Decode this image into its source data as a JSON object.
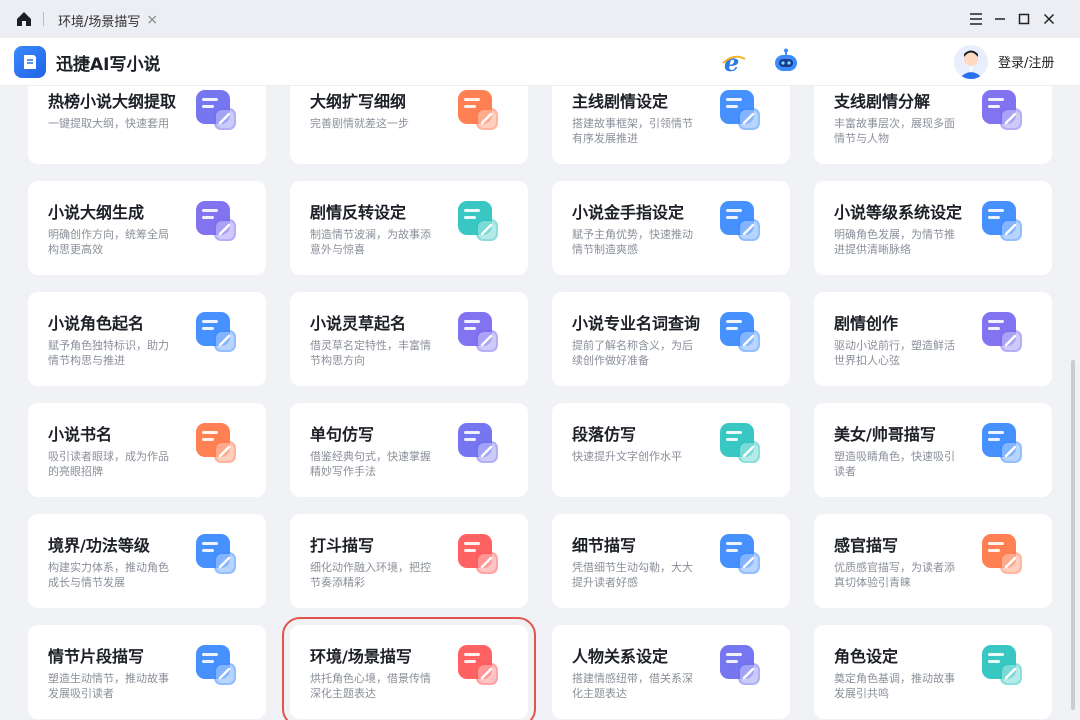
{
  "tab": {
    "label": "环境/场景描写",
    "close": "×"
  },
  "app": {
    "title": "迅捷AI写小说"
  },
  "header": {
    "login_label": "登录/注册"
  },
  "cards": [
    {
      "title": "热榜小说大纲提取",
      "desc": "一键提取大纲，快速套用",
      "icon": "layers-fire-icon",
      "color": "#6f6ff0"
    },
    {
      "title": "大纲扩写细纲",
      "desc": "完善剧情就差这一步",
      "icon": "list-expand-icon",
      "color": "#ff7a4a"
    },
    {
      "title": "主线剧情设定",
      "desc": "搭建故事框架，引领情节有序发展推进",
      "icon": "plot-settings-icon",
      "color": "#3d8bff"
    },
    {
      "title": "支线剧情分解",
      "desc": "丰富故事层次，展现多面情节与人物",
      "icon": "branch-plot-icon",
      "color": "#7b6cf0"
    },
    {
      "title": "小说大纲生成",
      "desc": "明确创作方向，统筹全局构思更高效",
      "icon": "outline-generate-icon",
      "color": "#7b6cf0"
    },
    {
      "title": "剧情反转设定",
      "desc": "制造情节波澜，为故事添意外与惊喜",
      "icon": "plot-twist-icon",
      "color": "#2ec4c0"
    },
    {
      "title": "小说金手指设定",
      "desc": "赋予主角优势，快速推动情节制造爽感",
      "icon": "golden-finger-icon",
      "color": "#3d8bff"
    },
    {
      "title": "小说等级系统设定",
      "desc": "明确角色发展，为情节推进提供清晰脉络",
      "icon": "level-system-icon",
      "color": "#3d8bff"
    },
    {
      "title": "小说角色起名",
      "desc": "赋予角色独特标识，助力情节构思与推进",
      "icon": "character-name-icon",
      "color": "#3d8bff"
    },
    {
      "title": "小说灵草起名",
      "desc": "借灵草名定特性，丰富情节构思方向",
      "icon": "herb-name-icon",
      "color": "#7b6cf0"
    },
    {
      "title": "小说专业名词查询",
      "desc": "提前了解名称含义，为后续创作做好准备",
      "icon": "term-search-icon",
      "color": "#3d8bff"
    },
    {
      "title": "剧情创作",
      "desc": "驱动小说前行，塑造鲜活世界扣人心弦",
      "icon": "plot-writing-icon",
      "color": "#7b6cf0"
    },
    {
      "title": "小说书名",
      "desc": "吸引读者眼球，成为作品的亮眼招牌",
      "icon": "book-title-icon",
      "color": "#ff7a4a"
    },
    {
      "title": "单句仿写",
      "desc": "借鉴经典句式，快速掌握精妙写作手法",
      "icon": "sentence-rewrite-icon",
      "color": "#6f6ff0"
    },
    {
      "title": "段落仿写",
      "desc": "快速提升文字创作水平",
      "icon": "paragraph-rewrite-icon",
      "color": "#2ec4c0"
    },
    {
      "title": "美女/帅哥描写",
      "desc": "塑造吸睛角色，快速吸引读者",
      "icon": "beauty-portrait-icon",
      "color": "#3d8bff"
    },
    {
      "title": "境界/功法等级",
      "desc": "构建实力体系，推动角色成长与情节发展",
      "icon": "realm-level-icon",
      "color": "#3d8bff"
    },
    {
      "title": "打斗描写",
      "desc": "细化动作融入环境，把控节奏添精彩",
      "icon": "fight-scene-icon",
      "color": "#ff5a5a"
    },
    {
      "title": "细节描写",
      "desc": "凭借细节生动勾勒，大大提升读者好感",
      "icon": "detail-writing-icon",
      "color": "#3d8bff"
    },
    {
      "title": "感官描写",
      "desc": "优质感官描写，为读者添真切体验引青睐",
      "icon": "sensory-lips-icon",
      "color": "#ff7a4a"
    },
    {
      "title": "情节片段描写",
      "desc": "塑造生动情节，推动故事发展吸引读者",
      "icon": "plot-fragment-icon",
      "color": "#3d8bff"
    },
    {
      "title": "环境/场景描写",
      "desc": "烘托角色心境，借景传情深化主题表达",
      "icon": "scene-leaf-icon",
      "color": "#ff5a5a"
    },
    {
      "title": "人物关系设定",
      "desc": "搭建情感纽带，借关系深化主题表达",
      "icon": "relationship-icon",
      "color": "#6f6ff0"
    },
    {
      "title": "角色设定",
      "desc": "奠定角色基调，推动故事发展引共鸣",
      "icon": "role-mask-icon",
      "color": "#2ec4c0"
    }
  ],
  "selected_index": 21
}
